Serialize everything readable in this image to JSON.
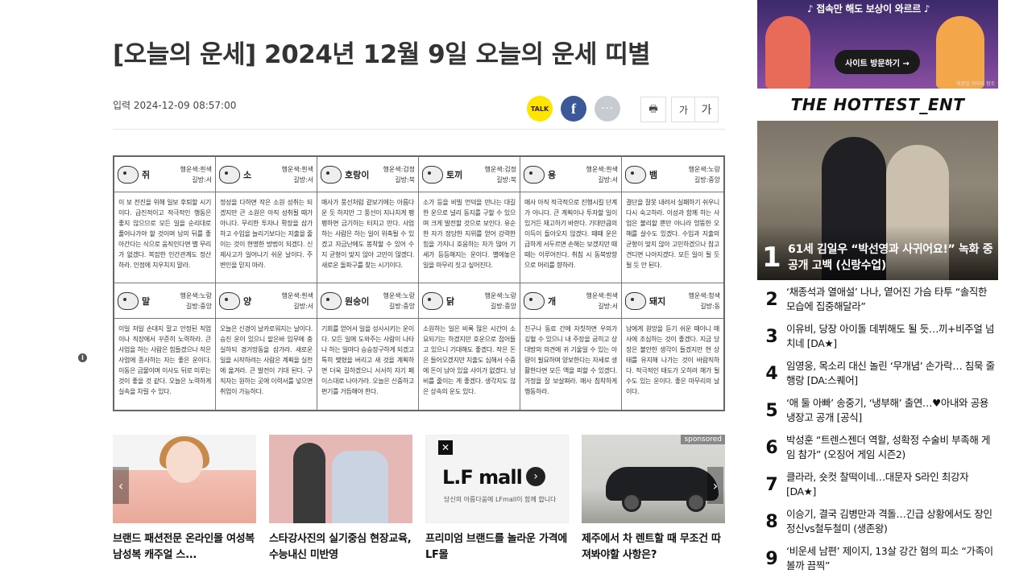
{
  "article": {
    "headline": "[오늘의 운세] 2024년 12월 9일 오늘의 운세 띠별",
    "dateline": "입력 2024-12-09 08:57:00",
    "share": {
      "kakao_label": "TALK",
      "facebook_label": "f",
      "more_label": "···"
    },
    "tools": {
      "print_label": "🖶",
      "font_small": "가",
      "font_large": "가"
    }
  },
  "fortune": [
    {
      "animal": "쥐",
      "meta1": "행운색:흰색",
      "meta2": "길방:서",
      "text": "이 보 전진을 위해 일보 후퇴할 시기이다. 급진적이고 적극적인 행동은 좋지 않으므로 모든 일을 순리대로 풀어나가야 할 것이며 남의 뒤를 좋아간다는 식으로 움직인다면 별 무리가 없겠다. 복잡한 인간관계도 정산하라. 인정에 치우치지 말라."
    },
    {
      "animal": "소",
      "meta1": "행운색:흰색",
      "meta2": "길방:서",
      "text": "정성을 다하면 작은 소원 성취는 되겠지만 큰 소원은 아직 성취될 때가 아니다. 무리한 투자나 확장을 삼가하고 수입을 늘리기보다는 지출을 줄이는 것이 현명한 방법이 되겠다. 신제사고가 일어나기 쉬운 날이다. 주변인을 믿지 마라."
    },
    {
      "animal": "호랑이",
      "meta1": "행운색:검정",
      "meta2": "길방:북",
      "text": "매사가 풍선처럼 겉보기에는 아름다운 듯 하지만 그 풍선이 지나치게 팽팽하면 금기하는 터지고 만다. 사업하는 사람은 하는 일이 위축될 수 있겠고 자금난에도 봉착할 수 있어 수지 균형이 맞지 않아 고민이 많겠다. 새로운 돌파구를 찾는 시기이다."
    },
    {
      "animal": "토끼",
      "meta1": "행운색:검정",
      "meta2": "길방:북",
      "text": "소가 등을 비빌 언덕을 만나는 대길한 운으로 널리 동지를 구할 수 있으며 크게 발전할 것으로 보인다. 유순한 자가 정당한 지위를 얻어 강력한 힘을 가지니 호응하는 자가 많아 기세가 등등해지는 운이다. 별에놓은 일을 마무리 짓고 싶어진다."
    },
    {
      "animal": "용",
      "meta1": "행운색:흰색",
      "meta2": "길방:서",
      "text": "매사 아직 적극적으로 진행시킬 단계가 아니다. 큰 계획이나 투자할 일이 있거든 재고하기 바란다. 기대만큼의 이득이 돌아오지 않겠다. 때때 운은 급하게 서두르면 손해는 보겠지만 때때는 이루어진다. 취침 시 동북방향으로 머리를 향하라."
    },
    {
      "animal": "뱀",
      "meta1": "행운색:노랑",
      "meta2": "길방:중앙",
      "text": "결단을 잘못 내려서 실패하기 쉬우니 다시 숙고하라. 이성과 함께 하는 사업은 불리할 뿐만 아니라 엉뚱한 오해를 살수도 있겠다. 수입과 지출의 균형이 맞지 않아 고민하겠으나 참고 견디면 나아지겠다. 모든 일이 될 듯 될 듯 안 된다."
    },
    {
      "animal": "말",
      "meta1": "행운색:노랑",
      "meta2": "길방:중앙",
      "text": "이일 저일 손대지 말고 안정된 직업이나 직장에서 꾸준히 노력하라. 큰 사업을 하는 사람은 힘들겠으나 작은 사업에 종사하는 자는 좋은 운이다. 이동은 금물이며 이사도 뒤로 미루는 것이 좋을 것 같다. 오늘은 노력하게 실속을 차릴 수 있다."
    },
    {
      "animal": "양",
      "meta1": "행운색:흰색",
      "meta2": "길방:서",
      "text": "오늘은 신경이 날카로워지는 날이다. 승진 운이 있으니 맡은바 임무에 충실하되 경거망동을 삼가라. 새로운 일을 시작하려는 사람은 계획을 실천에 옮겨라. 큰 발전이 기대 된다. 구직자는 원하는 곳에 이력서를 넣으면 취업이 가능하다."
    },
    {
      "animal": "원숭이",
      "meta1": "행운색:노랑",
      "meta2": "길방:중앙",
      "text": "기회를 얻어서 일을 성사시키는 운이다. 모든 일에 도와주는 사람이 나타나 하는 일마다 승승장구하게 되겠고 특히 맺혔을 버리고 새 것을 계획하면 더욱 길하겠으니 서서히 자기 페이스대로 나아가라. 오늘은 신중하고 편기를 거듭해야 한다."
    },
    {
      "animal": "닭",
      "meta1": "행운색:노랑",
      "meta2": "길방:중앙",
      "text": "소원하는 일은 비록 많은 시간이 소요되기는 하겠지만 호운으로 접어들고 있으니 기대해도 좋겠다. 작은 돈은 들어오겠지만 지출도 심해서 수중에 돈이 남아 있을 사이가 없겠다. 낭비를 줄이는 게 좋겠다. 생각지도 않은 상속의 운도 있다."
    },
    {
      "animal": "개",
      "meta1": "행운색:흰색",
      "meta2": "길방:서",
      "text": "친구나 동료 간에 자칫하면 우의가 깊혈 수 있으니 내 주장을 굽히고 상대방의 의견에 귀 기울일 수 있는 아량이 필요하며 양보한다는 자세로 생활한다면 모든 액을 피할 수 있겠다. 가정을 잘 보살펴라. 매사 침착하게 행동하라."
    },
    {
      "animal": "돼지",
      "meta1": "행운색:청색",
      "meta2": "길방:동",
      "text": "남에게 원망을 듣기 쉬운 때이니 매사에 조심하는 것이 좋겠다. 지금 당장은 불안한 생각이 들겠지만 현 상태를 유지해 나가는 것이 바람직하다. 적극적인 태도가 오히려 해가 될 수도 있는 운이다. 좋은 마무리의 날이다."
    }
  ],
  "cards": [
    {
      "title": "브랜드 패션전문 온라인몰 여성복 남성복 캐주얼 스..."
    },
    {
      "title": "스타강사진의 실기중심 현장교육, 수능내신 미반영"
    },
    {
      "title": "프리미엄 브랜드를 놀라운 가격에 LF몰",
      "logo": "L.F mall",
      "tagline": "당신의 아름다움에 LFmall이 함께 합니다"
    },
    {
      "title": "제주에서 차 렌트할 때 무조건 따져봐야할 사항은?",
      "badge": "sponsored"
    }
  ],
  "sidebar": {
    "banner": {
      "text": "♪ 접속만 해도 보상이 와르르 ♪",
      "button": "사이트 방문하기 →",
      "footer": "제품별 이미지 참조"
    },
    "hot_title": "THE HOTTEST_ENT",
    "top_story": {
      "rank": "1",
      "caption": "61세 김일우 “박선영과 사귀어요!” 녹화 중 공개 고백 (신랑수업)"
    },
    "items": [
      {
        "rank": "2",
        "text": "‘채종석과 열애설’ 나나, 옅어진 가슴 타투 “솔직한 모습에 집중해달라”"
      },
      {
        "rank": "3",
        "text": "이유비, 당장 아이돌 데뷔해도 될 듯…끼+비주얼 넘치네 [DA★]"
      },
      {
        "rank": "4",
        "text": "임영웅, 목소리 대신 놀린 ‘무개념’ 손가락… 침묵 줄행랑 [DA:스퀘어]"
      },
      {
        "rank": "5",
        "text": "‘애 둘 아빠’ 송중기, ‘냉부해’ 출연…♥아내와 공용 냉장고 공개 [공식]"
      },
      {
        "rank": "6",
        "text": "박성훈 “트렌스젠더 역할, 성확정 수술비 부족해 게임 참가” (오징어 게임 시즌2)"
      },
      {
        "rank": "7",
        "text": "클라라, 숏컷 찰떡이네…대문자 S라인 최강자 [DA★]"
      },
      {
        "rank": "8",
        "text": "이승기, 결국 김병만과 격돌…긴급 상황에서도 장인정신vs철두철미 (생존왕)"
      },
      {
        "rank": "9",
        "text": "‘비운세 남편’ 제이지, 13살 강간 혐의 피소 “가족이 볼까 끔찍”"
      }
    ]
  }
}
